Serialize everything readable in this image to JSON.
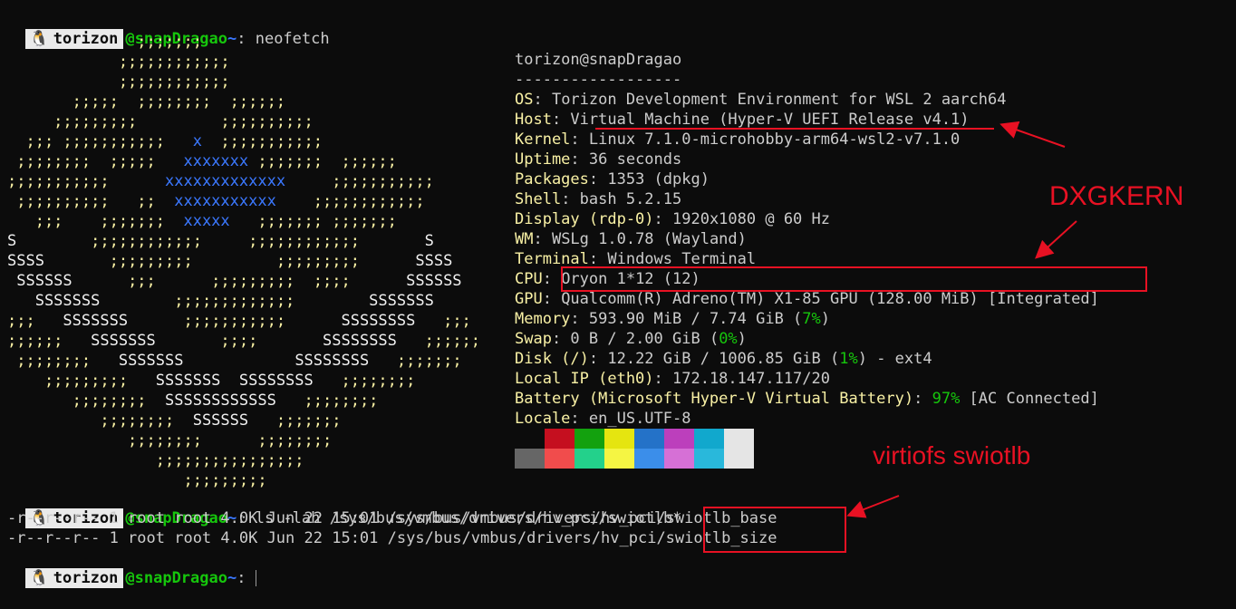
{
  "prompt": {
    "tux": "🐧",
    "user": "torizon",
    "host": "@snapDragao",
    "tilde": "~",
    "sep": ": "
  },
  "commands": {
    "neofetch": "neofetch",
    "ls": "ls -lah /sys/bus/vmbus/drivers/hv_pci/swiotlb*"
  },
  "ls_output": [
    "-r--r--r-- 1 root root 4.0K Jun 22 15:01 /sys/bus/vmbus/drivers/hv_pci/swiotlb_base",
    "-r--r--r-- 1 root root 4.0K Jun 22 15:01 /sys/bus/vmbus/drivers/hv_pci/swiotlb_size"
  ],
  "info": {
    "title": "torizon@snapDragao",
    "underline": "------------------",
    "rows": [
      {
        "k": "OS",
        "v": ": Torizon Development Environment for WSL 2 aarch64"
      },
      {
        "k": "Host",
        "v": ": Virtual Machine (Hyper-V UEFI Release v4.1)"
      },
      {
        "k": "Kernel",
        "v": ": Linux 7.1.0-microhobby-arm64-wsl2-v7.1.0"
      },
      {
        "k": "Uptime",
        "v": ": 36 seconds"
      },
      {
        "k": "Packages",
        "v": ": 1353 (dpkg)"
      },
      {
        "k": "Shell",
        "v": ": bash 5.2.15"
      },
      {
        "k": "Display (rdp-0)",
        "v": ": 1920x1080 @ 60 Hz"
      },
      {
        "k": "WM",
        "v": ": WSLg 1.0.78 (Wayland)"
      },
      {
        "k": "Terminal",
        "v": ": Windows Terminal"
      },
      {
        "k": "CPU",
        "v": ": Oryon 1*12 (12)"
      },
      {
        "k": "GPU",
        "v": ": Qualcomm(R) Adreno(TM) X1-85 GPU (128.00 MiB) [Integrated]"
      },
      {
        "k": "Memory",
        "v": ": 593.90 MiB / 7.74 GiB (",
        "pct": "7%",
        "tail": ")"
      },
      {
        "k": "Swap",
        "v": ": 0 B / 2.00 GiB (",
        "pct": "0%",
        "tail": ")"
      },
      {
        "k": "Disk (/)",
        "v": ": 12.22 GiB / 1006.85 GiB (",
        "pct": "1%",
        "tail": ") - ext4"
      },
      {
        "k": "Local IP (eth0)",
        "v": ": 172.18.147.117/20"
      },
      {
        "k": "Battery (Microsoft Hyper-V Virtual Battery)",
        "v": ": ",
        "pct": "97%",
        "tail": " [AC Connected]"
      },
      {
        "k": "Locale",
        "v": ": en_US.UTF-8"
      }
    ]
  },
  "palette": {
    "top": [
      "#0c0c0c",
      "#c50f1f",
      "#13a10e",
      "#e5e510",
      "#2472c8",
      "#bc3fbc",
      "#11a8cd",
      "#e5e5e5"
    ],
    "bottom": [
      "#666666",
      "#f14c4c",
      "#23d18b",
      "#f5f543",
      "#3b8eea",
      "#d670d6",
      "#29b8db",
      "#e5e5e5"
    ]
  },
  "annotations": {
    "dxgkern": "DXGKERN",
    "virtiofs": "virtiofs swiotlb",
    "color": "#e81123"
  },
  "logo": [
    [
      [
        "y",
        "              ;;;;;;;"
      ]
    ],
    [
      [
        "y",
        "            ;;;;;;;;;;;;"
      ]
    ],
    [
      [
        "y",
        "            ;;;;;;;;;;;;"
      ]
    ],
    [
      [
        "y",
        "       ;;;;;  ;;;;;;;;  ;;;;;;"
      ]
    ],
    [
      [
        "y",
        "     ;;;;;;;;;         ;;;;;;;;;;"
      ]
    ],
    [
      [
        "y",
        "  ;;; ;;;;;;;;;;;   "
      ],
      [
        "b",
        "x"
      ],
      [
        "y",
        "  ;;;;;;;;;;;"
      ]
    ],
    [
      [
        "y",
        " ;;;;;;;;  ;;;;;   "
      ],
      [
        "b",
        "xxxxxxx"
      ],
      [
        "y",
        " ;;;;;;;  ;;;;;;"
      ]
    ],
    [
      [
        "y",
        ";;;;;;;;;;;      "
      ],
      [
        "b",
        "xxxxxxxxxxxxx"
      ],
      [
        "y",
        "     ;;;;;;;;;;;"
      ]
    ],
    [
      [
        "y",
        " ;;;;;;;;;;   ;;  "
      ],
      [
        "b",
        "xxxxxxxxxxx"
      ],
      [
        "y",
        "    ;;;;;;;;;;;;"
      ]
    ],
    [
      [
        "y",
        "   ;;;    ;;;;;;;  "
      ],
      [
        "b",
        "xxxxx"
      ],
      [
        "y",
        "   ;;;;;;; ;;;;;;;"
      ]
    ],
    [
      [
        "w",
        "S"
      ],
      [
        "y",
        "        ;;;;;;;;;;;;     ;;;;;;;;;;;;       "
      ],
      [
        "w",
        "S"
      ]
    ],
    [
      [
        "w",
        "SSSS"
      ],
      [
        "y",
        "       ;;;;;;;;;         ;;;;;;;;;      "
      ],
      [
        "w",
        "SSSS"
      ]
    ],
    [
      [
        "w",
        " SSSSSS"
      ],
      [
        "y",
        "      ;;;      ;;;;;;;;;  ;;;;      "
      ],
      [
        "w",
        "SSSSSS"
      ]
    ],
    [
      [
        "w",
        "   SSSSSSS"
      ],
      [
        "y",
        "        ;;;;;;;;;;;;;        "
      ],
      [
        "w",
        "SSSSSSS"
      ]
    ],
    [
      [
        "y",
        ";;;   "
      ],
      [
        "w",
        "SSSSSSS"
      ],
      [
        "y",
        "      ;;;;;;;;;;;      "
      ],
      [
        "w",
        "SSSSSSSS"
      ],
      [
        "y",
        "   ;;;"
      ]
    ],
    [
      [
        "y",
        ";;;;;;   "
      ],
      [
        "w",
        "SSSSSSS"
      ],
      [
        "y",
        "       ;;;;       "
      ],
      [
        "w",
        "SSSSSSSS"
      ],
      [
        "y",
        "   ;;;;;;"
      ]
    ],
    [
      [
        "y",
        " ;;;;;;;;   "
      ],
      [
        "w",
        "SSSSSSS"
      ],
      [
        "y",
        "            "
      ],
      [
        "w",
        "SSSSSSSS"
      ],
      [
        "y",
        "   ;;;;;;;"
      ]
    ],
    [
      [
        "y",
        "    ;;;;;;;;;   "
      ],
      [
        "w",
        "SSSSSSS  SSSSSSSS"
      ],
      [
        "y",
        "   ;;;;;;;;"
      ]
    ],
    [
      [
        "y",
        "       ;;;;;;;;  "
      ],
      [
        "w",
        "SSSSSSSSSSSS"
      ],
      [
        "y",
        "   ;;;;;;;;"
      ]
    ],
    [
      [
        "y",
        "          ;;;;;;;;  "
      ],
      [
        "w",
        "SSSSSS"
      ],
      [
        "y",
        "   ;;;;;;;"
      ]
    ],
    [
      [
        "y",
        "             ;;;;;;;;      ;;;;;;;;"
      ]
    ],
    [
      [
        "y",
        "                ;;;;;;;;;;;;;;;;"
      ]
    ],
    [
      [
        "y",
        "                   ;;;;;;;;;"
      ]
    ]
  ]
}
